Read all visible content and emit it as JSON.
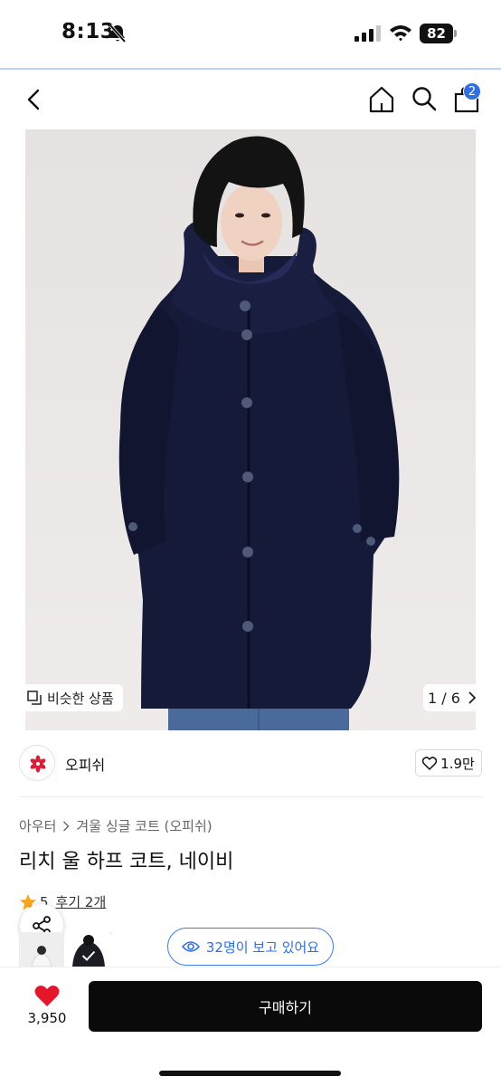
{
  "status_bar": {
    "time": "8:13",
    "battery": "82"
  },
  "header": {
    "cart_count": "2"
  },
  "gallery": {
    "similar_label": "비슷한 상품",
    "pager": "1 / 6"
  },
  "shop": {
    "name": "오피쉬",
    "likes": "1.9만"
  },
  "product": {
    "breadcrumb": [
      "아우터",
      "겨울 싱글 코트 (오피쉬)"
    ],
    "title": "리치 울 하프 코트, 네이비",
    "rating": "5",
    "reviews": "후기 2개",
    "viewers": "32명이 보고 있어요"
  },
  "bottom_bar": {
    "wish_count": "3,950",
    "buy_label": "구매하기"
  },
  "colors": {
    "accent": "#2f6fe0",
    "wish_heart": "#e3162b",
    "star": "#f5a623",
    "coat": "#161a38",
    "buy_button": "#0a0a0a"
  },
  "icons": [
    "bell-muted-icon",
    "signal-icon",
    "wifi-icon",
    "battery-icon",
    "back-icon",
    "home-icon",
    "search-icon",
    "bag-icon",
    "similar-icon",
    "chevron-right-icon",
    "heart-outline-icon",
    "star-icon",
    "share-icon",
    "eye-icon",
    "heart-filled-icon"
  ]
}
